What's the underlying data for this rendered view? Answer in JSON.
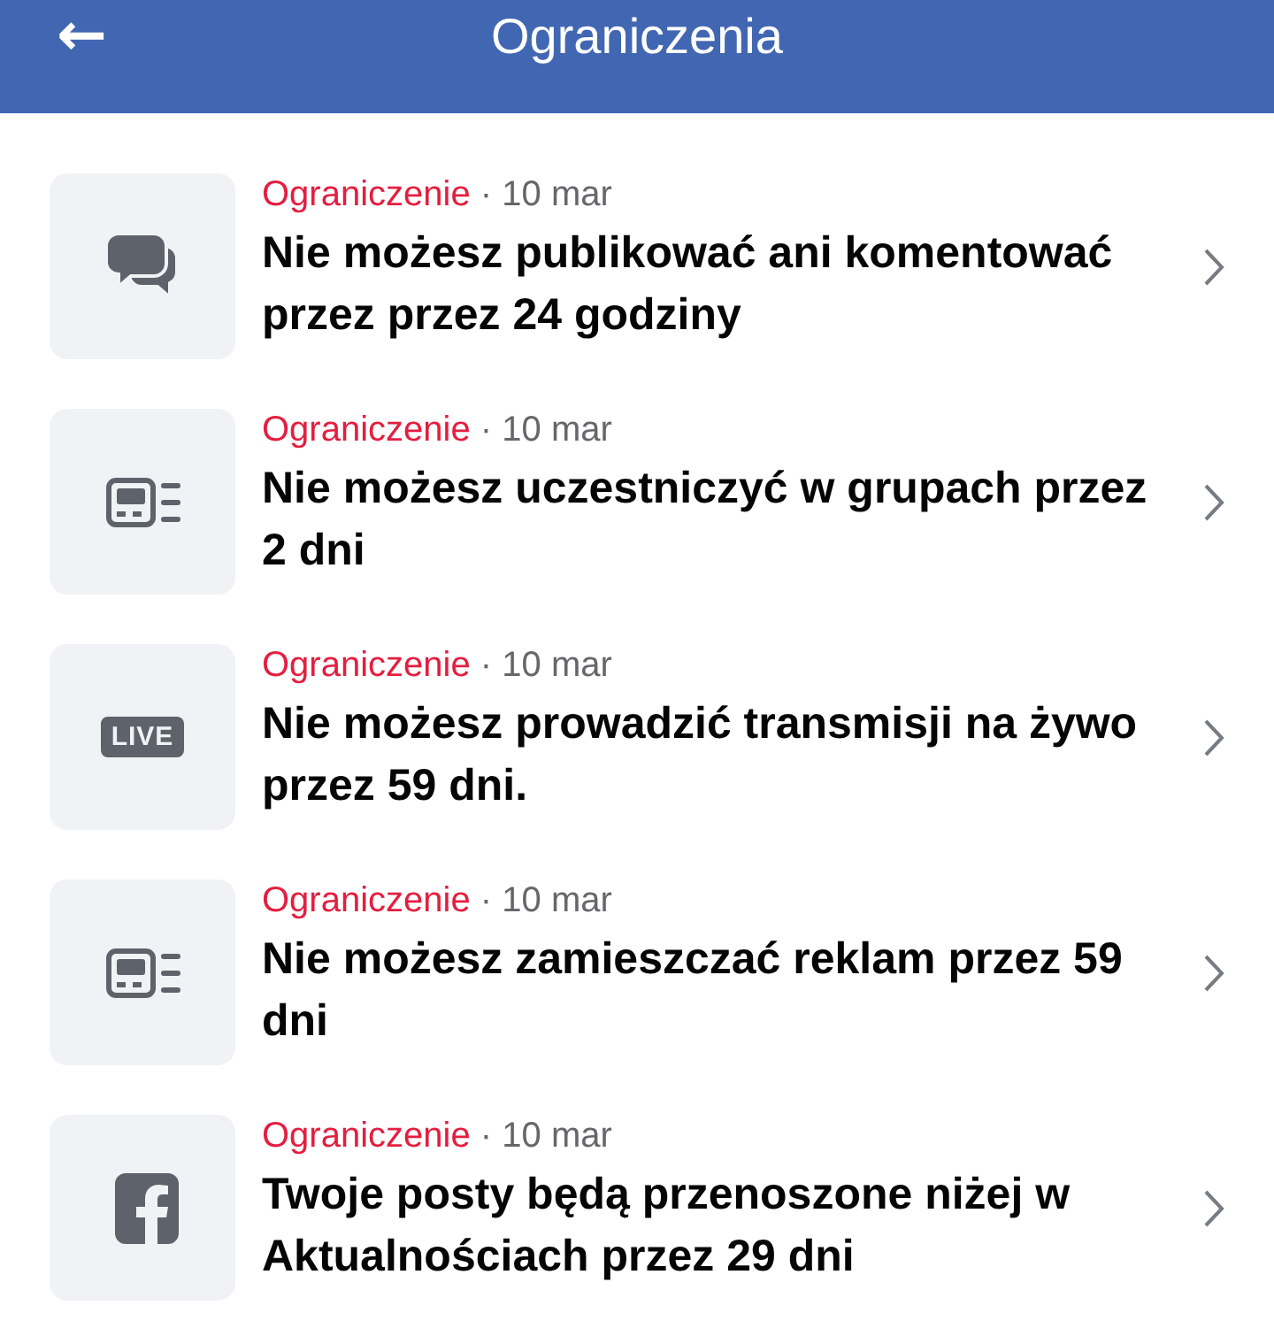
{
  "header": {
    "back_icon": "←",
    "title": "Ograniczenia"
  },
  "restrictions": [
    {
      "kind": "chat",
      "label": "Ograniczenie",
      "separator": "·",
      "date": "10 mar",
      "text": "Nie możesz publikować ani komentować przez przez 24 godziny"
    },
    {
      "kind": "groups",
      "label": "Ograniczenie",
      "separator": "·",
      "date": "10 mar",
      "text": "Nie możesz uczestniczyć w grupach przez 2 dni"
    },
    {
      "kind": "live",
      "badge_text": "LIVE",
      "label": "Ograniczenie",
      "separator": "·",
      "date": "10 mar",
      "text": "Nie możesz prowadzić transmisji na żywo przez 59 dni."
    },
    {
      "kind": "groups",
      "label": "Ograniczenie",
      "separator": "·",
      "date": "10 mar",
      "text": "Nie możesz zamieszczać reklam przez 59 dni"
    },
    {
      "kind": "facebook",
      "label": "Ograniczenie",
      "separator": "·",
      "date": "10 mar",
      "text": "Twoje posty będą przenoszone niżej w Aktualnościach przez 29 dni"
    }
  ]
}
